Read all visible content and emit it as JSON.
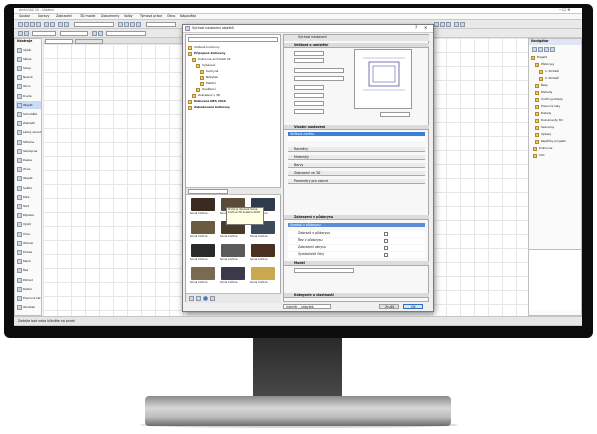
{
  "app": {
    "title": "ArchiCAD 20 - Uložení",
    "menu": [
      "Soubor",
      "Úpravy",
      "Zobrazení",
      "3D model",
      "Dokumenty",
      "Volby",
      "Týmová práce",
      "Okno",
      "Nápověda"
    ]
  },
  "toolbox": {
    "header": "Nástroje",
    "items": [
      "Výběr",
      "Stěna",
      "Sloup",
      "Nosník",
      "Okno",
      "Dveře",
      "Objekt",
      "Schodiště",
      "Zábradlí",
      "Lehký obvod",
      "Střecha",
      "Skořepina",
      "Deska",
      "Zóna",
      "Objekt",
      "Světlo",
      "Kóta",
      "Text",
      "Popiska",
      "Výplň",
      "Čára",
      "Oblouk",
      "Křivka",
      "Mesh",
      "Řez",
      "Pohled",
      "Detail",
      "Pracovní list",
      "Obrázek"
    ]
  },
  "dialog": {
    "title": "Výchozí nastavení objektů",
    "folder_tree": [
      "Vložené knihovny",
      "Připojené knihovny",
      "Knihovna ArchiCAD 20",
      "Vybavení",
      "Kuchyně",
      "Nábytek",
      "Elektro",
      "Osvětlení",
      "Zobrazení v 3D",
      "Knihovna DEA 2016",
      "Zabudované knihovny"
    ],
    "search_placeholder": "Hledat",
    "tile_labels": [
      "Sonia Cortina",
      "Sonia Cortina",
      "Sonia Cortina",
      "Sonia Cortina",
      "Sonia Cortina",
      "Sonia Cortina",
      "Sonia Cortina",
      "Sonia Cortina",
      "Sonia Cortina",
      "Sonia Cortina",
      "Sonia Cortina",
      "Sonia Cortina"
    ],
    "tooltip": "Prvkový doplněk Sonia Cortina 3D kolekce 2016",
    "preview_header": "Výchozí nastavení",
    "sections": [
      "Velikost a umístění",
      "Vlastní nastavení",
      "Zobrazení v půdorysu",
      "Vlastnosti modelu",
      "Kategorie a vlastnosti"
    ],
    "subsections": [
      "Rozměry",
      "Materiály",
      "Barvy",
      "Zobrazení ve 3D",
      "Parametry pro vzorce"
    ],
    "highlight_row": "Velikost závěsu",
    "ok_label": "OK",
    "cancel_label": "Zrušit",
    "layer_label": "Interiér - nábytek",
    "sub_section_label": "Symbol v půdorysu",
    "toggle_rows": [
      "Zobrazit v půdorysu",
      "Řez v půdorysu",
      "Zobrazení obrysu",
      "Symbolické čáry"
    ],
    "model_label": "Model"
  },
  "navigator": {
    "header": "Navigátor",
    "items": [
      "Projekt",
      "Půdorysy",
      "1. Podlaží",
      "2. Podlaží",
      "Řezy",
      "Pohledy",
      "Vnitřní pohledy",
      "Pracovní listy",
      "Detaily",
      "Dokumenty 3D",
      "Seznamy",
      "Výkazy",
      "Rejstříky projektu",
      "Knihovna",
      "Info"
    ]
  },
  "status_bar": {
    "text": "Zadejte bod nebo klikněte na prvek"
  }
}
